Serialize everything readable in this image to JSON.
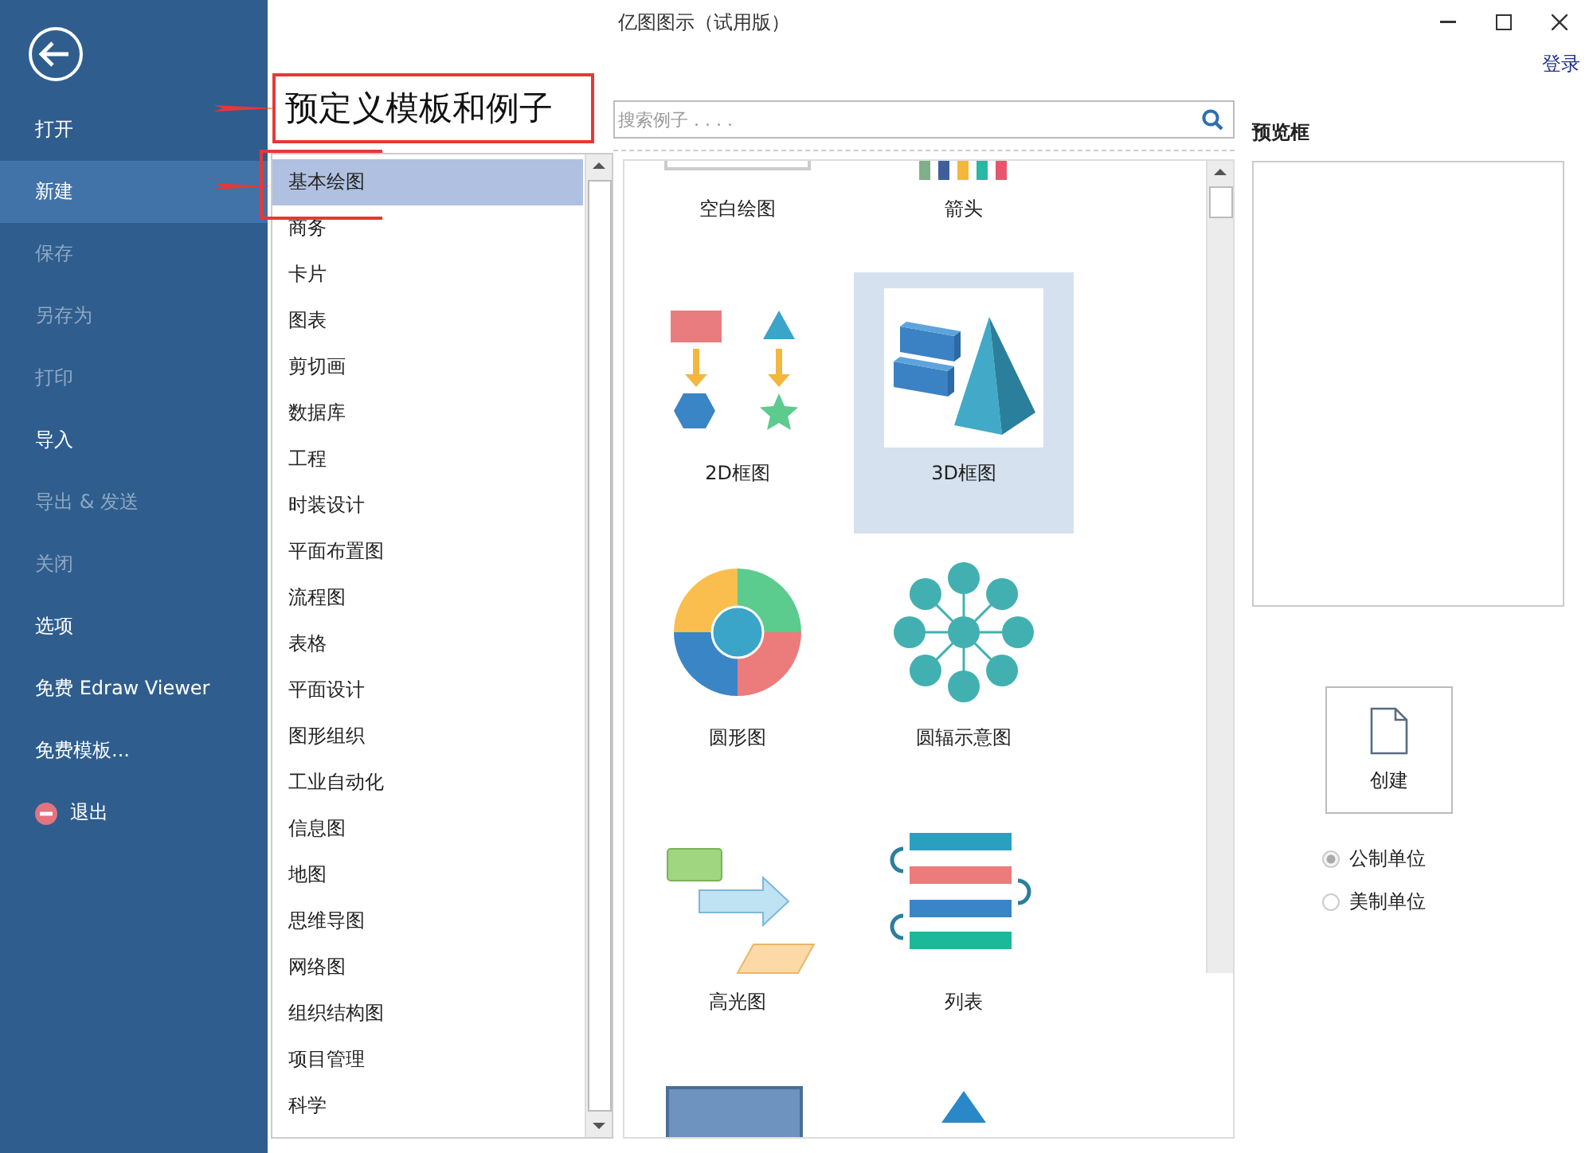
{
  "window": {
    "title": "亿图图示（试用版）",
    "login": "登录"
  },
  "sidebar": {
    "items": [
      {
        "kind": "text",
        "label": "打开",
        "selected": false,
        "disabled": false
      },
      {
        "kind": "text",
        "label": "新建",
        "selected": true,
        "disabled": false
      },
      {
        "kind": "text",
        "label": "保存",
        "selected": false,
        "disabled": true
      },
      {
        "kind": "text",
        "label": "另存为",
        "selected": false,
        "disabled": true
      },
      {
        "kind": "text",
        "label": "打印",
        "selected": false,
        "disabled": true
      },
      {
        "kind": "text",
        "label": "导入",
        "selected": false,
        "disabled": false
      },
      {
        "kind": "text",
        "label": "导出 & 发送",
        "selected": false,
        "disabled": true
      },
      {
        "kind": "text",
        "label": "关闭",
        "selected": false,
        "disabled": true
      },
      {
        "kind": "text",
        "label": "选项",
        "selected": false,
        "disabled": false
      },
      {
        "kind": "text",
        "label": "免费 Edraw Viewer",
        "selected": false,
        "disabled": false
      },
      {
        "kind": "text",
        "label": "免费模板...",
        "selected": false,
        "disabled": false
      },
      {
        "kind": "exit",
        "label": "退出",
        "selected": false,
        "disabled": false
      }
    ]
  },
  "heading": "预定义模板和例子",
  "categories": [
    {
      "label": "基本绘图",
      "selected": true
    },
    {
      "label": "商务",
      "selected": false
    },
    {
      "label": "卡片",
      "selected": false
    },
    {
      "label": "图表",
      "selected": false
    },
    {
      "label": "剪切画",
      "selected": false
    },
    {
      "label": "数据库",
      "selected": false
    },
    {
      "label": "工程",
      "selected": false
    },
    {
      "label": "时装设计",
      "selected": false
    },
    {
      "label": "平面布置图",
      "selected": false
    },
    {
      "label": "流程图",
      "selected": false
    },
    {
      "label": "表格",
      "selected": false
    },
    {
      "label": "平面设计",
      "selected": false
    },
    {
      "label": "图形组织",
      "selected": false
    },
    {
      "label": "工业自动化",
      "selected": false
    },
    {
      "label": "信息图",
      "selected": false
    },
    {
      "label": "地图",
      "selected": false
    },
    {
      "label": "思维导图",
      "selected": false
    },
    {
      "label": "网络图",
      "selected": false
    },
    {
      "label": "组织结构图",
      "selected": false
    },
    {
      "label": "项目管理",
      "selected": false
    },
    {
      "label": "科学",
      "selected": false
    }
  ],
  "search": {
    "placeholder": "搜索例子 . . . ."
  },
  "templates": [
    {
      "kind": "blank",
      "label": "空白绘图",
      "selected": false
    },
    {
      "kind": "arrows",
      "label": "箭头",
      "selected": false
    },
    {
      "kind": "shapes",
      "label": "2D框图",
      "selected": false
    },
    {
      "kind": "blocks",
      "label": "3D框图",
      "selected": true
    },
    {
      "kind": "circle",
      "label": "圆形图",
      "selected": false
    },
    {
      "kind": "radial",
      "label": "圆辐示意图",
      "selected": false
    },
    {
      "kind": "highlight",
      "label": "高光图",
      "selected": false
    },
    {
      "kind": "list",
      "label": "列表",
      "selected": false
    },
    {
      "kind": "bar",
      "selected": false
    },
    {
      "kind": "triangle",
      "selected": false
    }
  ],
  "preview": {
    "label": "预览框"
  },
  "create_button": "创建",
  "units": [
    {
      "label": "公制单位",
      "selected": true
    },
    {
      "label": "美制单位",
      "selected": false
    }
  ]
}
